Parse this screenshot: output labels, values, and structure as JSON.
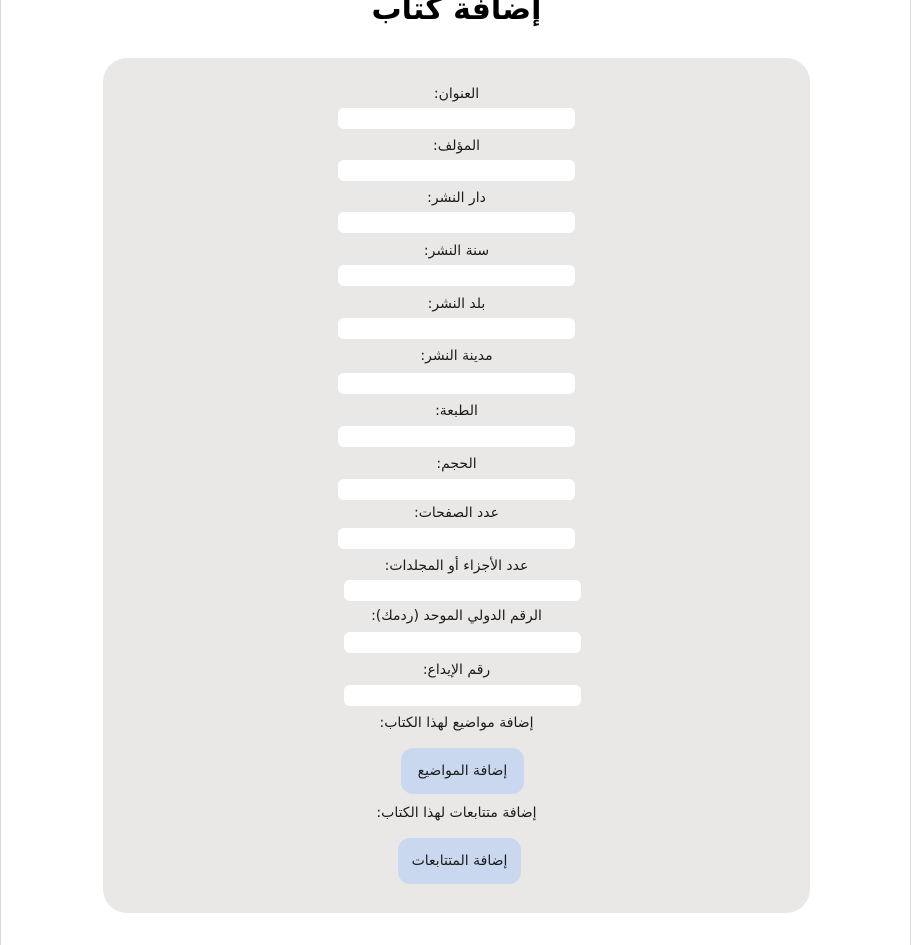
{
  "page": {
    "title": "إضافة كتاب"
  },
  "form": {
    "fields": [
      {
        "label": "العنوان:",
        "value": "",
        "placeholder": ""
      },
      {
        "label": "المؤلف:",
        "value": "",
        "placeholder": ""
      },
      {
        "label": "دار النشر:",
        "value": "",
        "placeholder": ""
      },
      {
        "label": "سنة النشر:",
        "value": "",
        "placeholder": ""
      },
      {
        "label": "بلد النشر:",
        "value": "",
        "placeholder": ""
      },
      {
        "label": "مدينة النشر:",
        "value": "",
        "placeholder": ""
      },
      {
        "label": "الطبعة:",
        "value": "",
        "placeholder": ""
      },
      {
        "label": "الحجم:",
        "value": "",
        "placeholder": ""
      },
      {
        "label": "عدد الصفحات:",
        "value": "",
        "placeholder": ""
      },
      {
        "label": "عدد الأجزاء أو المجلدات:",
        "value": "",
        "placeholder": ""
      },
      {
        "label": "الرقم الدولي الموحد (ردمك):",
        "value": "",
        "placeholder": ""
      },
      {
        "label": "رقم الإيداع:",
        "value": "",
        "placeholder": ""
      }
    ],
    "subjects": {
      "label": "إضافة مواضيع لهذا الكتاب:",
      "button_label": "إضافة المواضيع"
    },
    "series": {
      "label": "إضافة متتابعات لهذا الكتاب:",
      "button_label": "إضافة المتتابعات"
    }
  },
  "colors": {
    "panel_background": "#e9e8e7",
    "input_background": "#ffffff",
    "button_background": "#c9d8ef"
  }
}
